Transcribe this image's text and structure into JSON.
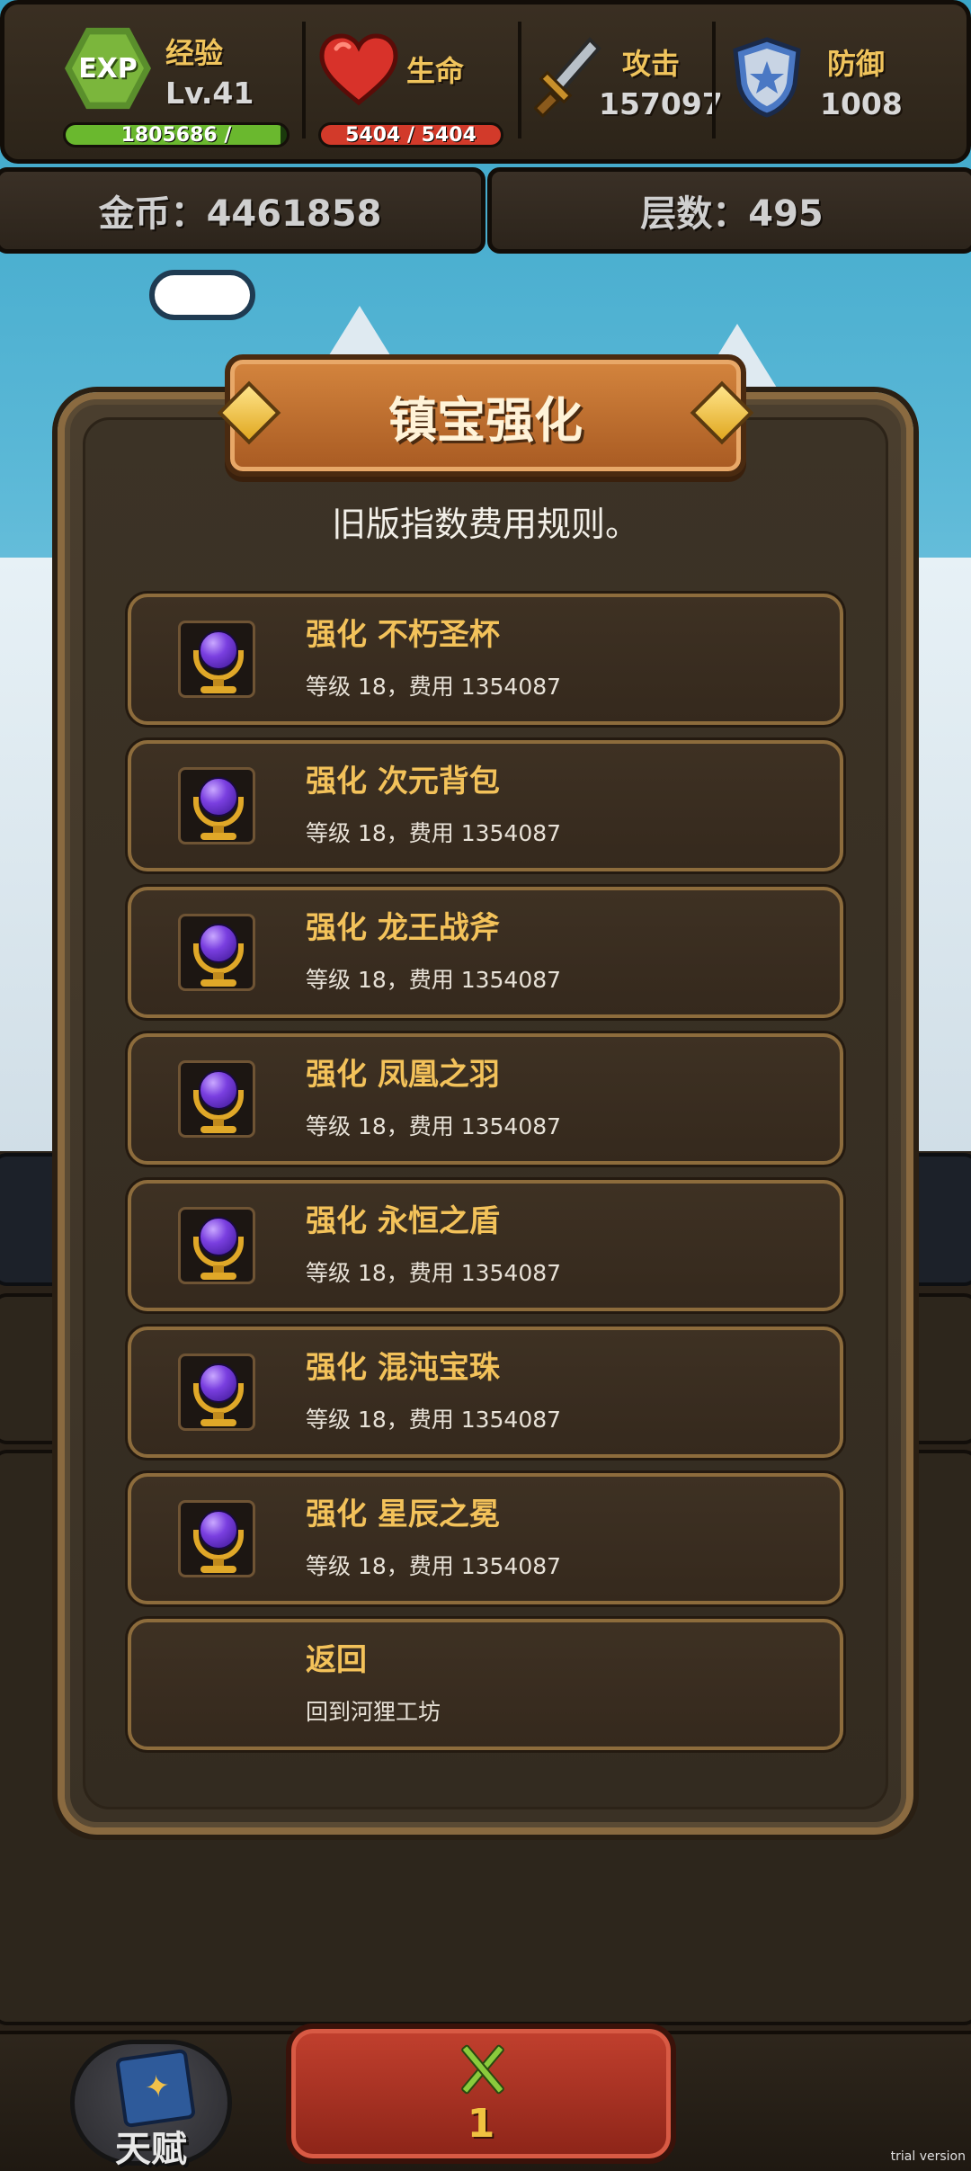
{
  "stats": {
    "exp": {
      "icon_text": "EXP",
      "label": "经验",
      "level": "Lv.41",
      "bar_text": "1805686 /",
      "bar_fill": 0.97
    },
    "hp": {
      "label": "生命",
      "bar_text": "5404 / 5404",
      "bar_fill": 1.0
    },
    "attack": {
      "label": "攻击",
      "value": "157097"
    },
    "defense": {
      "label": "防御",
      "value": "1008"
    }
  },
  "info": {
    "gold": "金币：4461858",
    "floor": "层数：495"
  },
  "dialog": {
    "title": "镇宝强化",
    "subtitle": "旧版指数费用规则。",
    "rows": [
      {
        "title": "强化 不朽圣杯",
        "desc": "等级 18，费用 1354087",
        "icon": "orb-trophy-icon"
      },
      {
        "title": "强化 次元背包",
        "desc": "等级 18，费用 1354087",
        "icon": "orb-trophy-icon"
      },
      {
        "title": "强化 龙王战斧",
        "desc": "等级 18，费用 1354087",
        "icon": "orb-trophy-icon"
      },
      {
        "title": "强化 凤凰之羽",
        "desc": "等级 18，费用 1354087",
        "icon": "orb-trophy-icon"
      },
      {
        "title": "强化 永恒之盾",
        "desc": "等级 18，费用 1354087",
        "icon": "orb-trophy-icon"
      },
      {
        "title": "强化 混沌宝珠",
        "desc": "等级 18，费用 1354087",
        "icon": "orb-trophy-icon"
      },
      {
        "title": "强化 星辰之冕",
        "desc": "等级 18，费用 1354087",
        "icon": "orb-trophy-icon"
      }
    ],
    "back": {
      "title": "返回",
      "desc": "回到河狸工坊"
    }
  },
  "bottom": {
    "talent_label": "天赋",
    "battle_count": "1"
  },
  "watermark": "trial version",
  "colors": {
    "accent_gold": "#f3c25a",
    "row_border": "#8d6c3c",
    "exp_bar": "#6ab82e",
    "hp_bar": "#d23a2a"
  }
}
